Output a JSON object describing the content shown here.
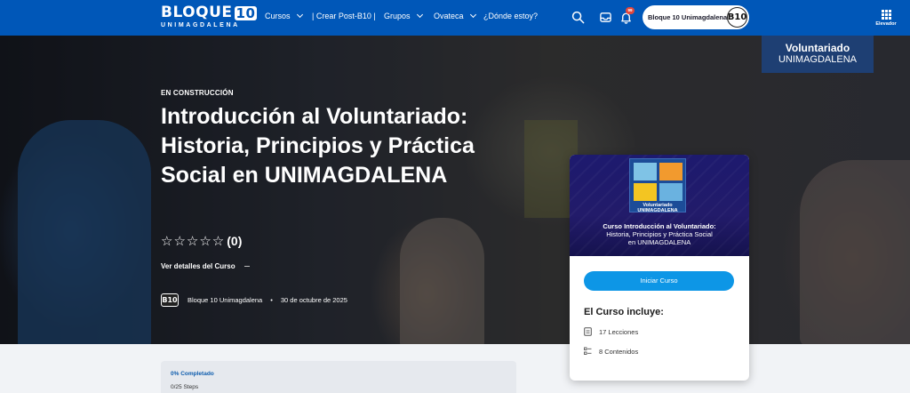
{
  "nav": {
    "logo_text": "BLOQUE",
    "logo_number": "10",
    "logo_sub": "UNIMAGDALENA",
    "items": [
      {
        "label": "Cursos",
        "has_dropdown": true
      },
      {
        "label": "| Crear Post-B10 |",
        "has_dropdown": false
      },
      {
        "label": "Grupos",
        "has_dropdown": true
      },
      {
        "label": "Ovateca",
        "has_dropdown": true
      },
      {
        "label": "¿Dónde estoy?",
        "has_dropdown": false
      }
    ],
    "notifications_badge": "99",
    "user_name": "Bloque 10 Unimagdalena",
    "avatar_text": "B10",
    "apps_label": "Elevador"
  },
  "hero": {
    "banner_line1": "Voluntariado",
    "banner_line2": "UNIMAGDALENA",
    "status": "EN CONSTRUCCIÓN",
    "title": "Introducción al Voluntariado: Historia, Principios y Práctica Social en UNIMAGDALENA",
    "stars": "☆☆☆☆☆",
    "rating_count": "(0)",
    "details_link": "Ver detalles del Curso",
    "author_logo": "B10",
    "author": "Bloque 10 Unimagdalena",
    "separator": "•",
    "date": "30 de octubre de 2025"
  },
  "card": {
    "logo_text": "Voluntariado UNIMAGDALENA",
    "image_line1": "Curso Introducción al Voluntariado:",
    "image_line2": "Historia, Principios y Práctica Social",
    "image_line3": "en UNIMAGDALENA",
    "start_button": "Iniciar Curso",
    "includes_title": "El Curso incluye:",
    "lessons": "17 Lecciones",
    "contents": "8 Contenidos"
  },
  "progress": {
    "percent_label": "0% Completado",
    "steps_label": "0/25 Steps",
    "percent": 0
  },
  "colors": {
    "nav_bg": "#0057b8",
    "button": "#0d96e6",
    "progress_text": "#0d5cad"
  }
}
